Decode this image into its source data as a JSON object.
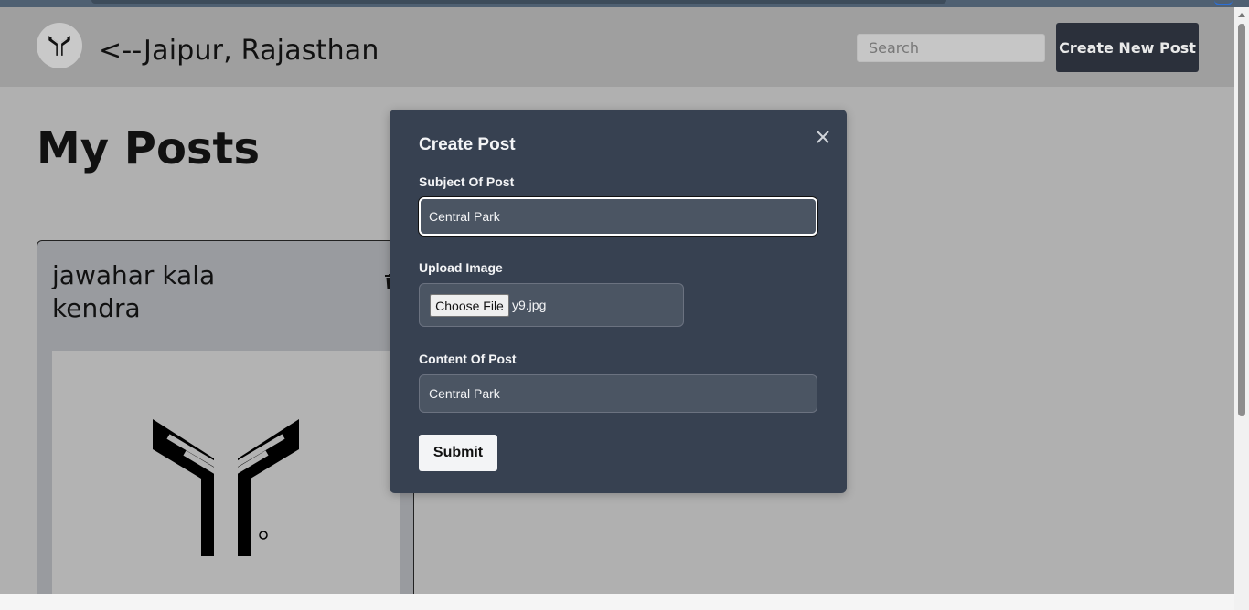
{
  "header": {
    "logo_icon": "ymca-logo-icon",
    "location_text": "<--Jaipur, Rajasthan",
    "search_placeholder": "Search",
    "create_button_label": "Create New Post"
  },
  "main": {
    "page_title": "My Posts",
    "posts": [
      {
        "title": "jawahar kala kendra",
        "delete_icon": "trash-icon",
        "image_icon": "ymca-logo-icon"
      }
    ]
  },
  "modal": {
    "title": "Create Post",
    "close_icon": "close-icon",
    "subject_label": "Subject Of Post",
    "subject_value": "Central Park",
    "upload_label": "Upload Image",
    "choose_file_label": "Choose File",
    "file_name": "y9.jpg",
    "content_label": "Content Of Post",
    "content_value": "Central Park",
    "submit_label": "Submit"
  },
  "colors": {
    "overlay_background": "#b0b0b0",
    "navbar_background": "#9f9f9f",
    "modal_background": "#374151",
    "field_background": "#4b5563",
    "create_button_background": "#2b303b"
  }
}
